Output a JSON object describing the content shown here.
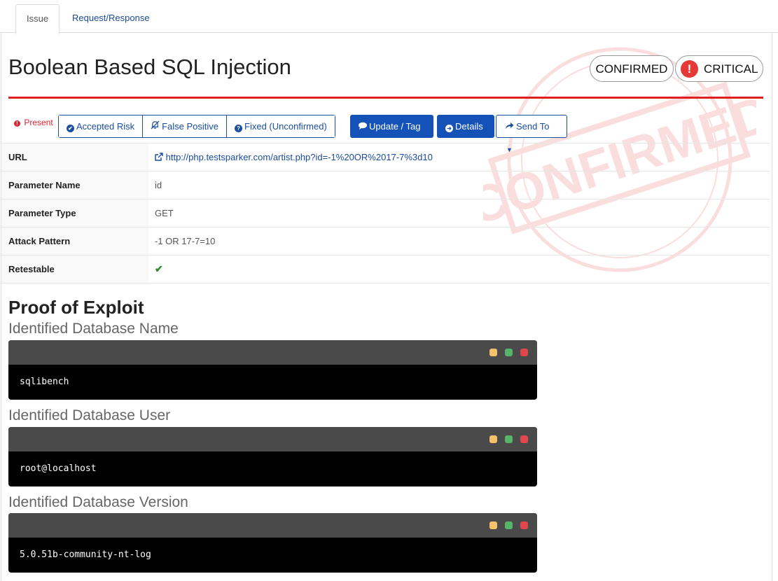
{
  "tabs": [
    {
      "label": "Issue",
      "active": true
    },
    {
      "label": "Request/Response",
      "active": false
    }
  ],
  "issue": {
    "title": "Boolean Based SQL Injection",
    "status_badge": "CONFIRMED",
    "severity_badge": "CRITICAL",
    "stamp_text": "CONFIRMED"
  },
  "actions": {
    "present_label": "Present",
    "accepted_risk": "Accepted Risk",
    "false_positive": "False Positive",
    "fixed_unconfirmed": "Fixed (Unconfirmed)",
    "update_tag": "Update / Tag",
    "details": "Details",
    "send_to": "Send To"
  },
  "properties": [
    {
      "key": "URL",
      "value": "http://php.testsparker.com/artist.php?id=-1%20OR%2017-7%3d10",
      "is_link": true
    },
    {
      "key": "Parameter Name",
      "value": "id"
    },
    {
      "key": "Parameter Type",
      "value": "GET"
    },
    {
      "key": "Attack Pattern",
      "value": "-1 OR 17-7=10"
    },
    {
      "key": "Retestable",
      "value": "✔",
      "is_check": true
    }
  ],
  "proof": {
    "heading": "Proof of Exploit",
    "items": [
      {
        "label": "Identified Database Name",
        "value": "sqlibench"
      },
      {
        "label": "Identified Database User",
        "value": "root@localhost"
      },
      {
        "label": "Identified Database Version",
        "value": "5.0.51b-community-nt-log"
      }
    ]
  },
  "colors": {
    "accent": "#1452b8",
    "severity_red": "#e53935",
    "rule_red": "#e02020",
    "terminal_lights": [
      "#f5c26b",
      "#57b56a",
      "#e0474c"
    ]
  }
}
